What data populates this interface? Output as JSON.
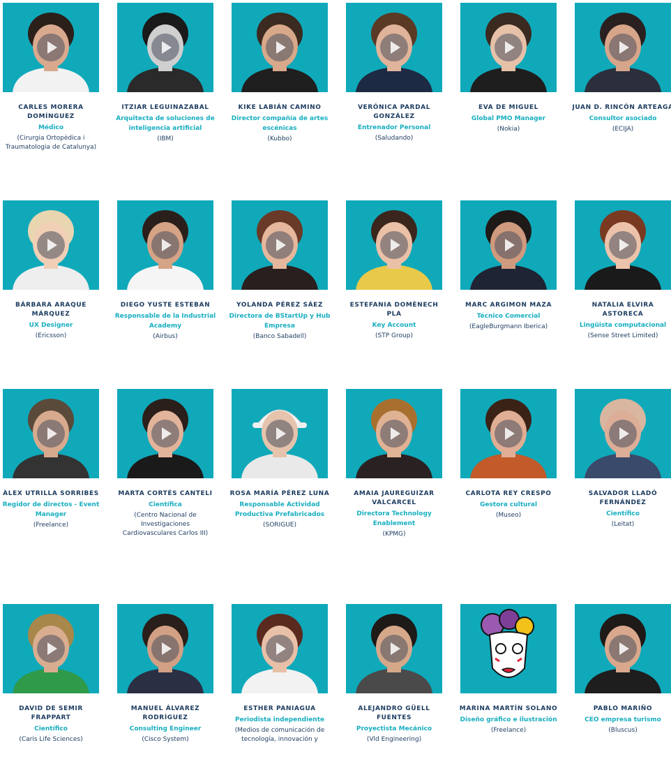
{
  "theme": {
    "photo_bg": "#0fa9ba",
    "name_color": "#1b3b5f",
    "role_color": "#18aec0"
  },
  "speakers": [
    {
      "name": "CARLES MORERA DOMÍNGUEZ",
      "role": "Médico",
      "company": "(Cirurgia Ortopèdica i Traumatologia de Catalunya)",
      "icon": "play-icon"
    },
    {
      "name": "ITZIAR LEGUINAZABAL",
      "role": "Arquitecta de soluciones de inteligencia artificial",
      "company": "(IBM)",
      "icon": "play-icon"
    },
    {
      "name": "KIKE LABIÁN CAMINO",
      "role": "Director compañía de artes escénicas",
      "company": "(Kubbo)",
      "icon": "play-icon"
    },
    {
      "name": "VERÓNICA PARDAL GONZÁLEZ",
      "role": "Entrenador Personal",
      "company": "(Saludando)",
      "icon": "play-icon"
    },
    {
      "name": "EVA DE MIGUEL",
      "role": "Global PMO Manager",
      "company": "(Nokia)",
      "icon": "play-icon"
    },
    {
      "name": "JUAN D. RINCÓN ARTEAGA",
      "role": "Consultor asociado",
      "company": "(ECIJA)",
      "icon": "play-icon"
    },
    {
      "name": "BÁRBARA ARAQUE MÁRQUEZ",
      "role": "UX Designer",
      "company": "(Ericsson)",
      "icon": "play-icon"
    },
    {
      "name": "DIEGO YUSTE ESTEBAN",
      "role": "Responsable de la Industrial Academy",
      "company": "(Airbus)",
      "icon": "play-icon"
    },
    {
      "name": "YOLANDA PÉREZ SÁEZ",
      "role": "Directora de BStartUp y Hub Empresa",
      "company": "(Banco Sabadell)",
      "icon": "play-icon"
    },
    {
      "name": "ESTEFANIA DOMÈNECH PLA",
      "role": "Key Account",
      "company": "(STP Group)",
      "icon": "play-icon"
    },
    {
      "name": "MARC ARGIMON MAZA",
      "role": "Técnico Comercial",
      "company": "(EagleBurgmann Iberica)",
      "icon": "play-icon"
    },
    {
      "name": "NATALIA ELVIRA ASTORECA",
      "role": "Lingüista computacional",
      "company": "(Sense Street Limited)",
      "icon": "play-icon"
    },
    {
      "name": "ÀLEX UTRILLA SORRIBES",
      "role": "Regidor de directos - Event Manager",
      "company": "(Freelance)",
      "icon": "play-icon"
    },
    {
      "name": "MARTA CORTÉS CANTELI",
      "role": "Científica",
      "company": "(Centro Nacional de Investigaciones Cardiovasculares Carlos III)",
      "icon": "play-icon"
    },
    {
      "name": "ROSA MARÍA PÉREZ LUNA",
      "role": "Responsable Actividad Productiva Prefabricados",
      "company": "(SORIGUE)",
      "icon": "play-icon"
    },
    {
      "name": "AMAIA JAUREGUIZAR VALCARCEL",
      "role": "Directora Technology Enablement",
      "company": "(KPMG)",
      "icon": "play-icon"
    },
    {
      "name": "CARLOTA REY CRESPO",
      "role": "Gestora cultural",
      "company": "(Museo)",
      "icon": "play-icon"
    },
    {
      "name": "SALVADOR LLADÓ FERNÁNDEZ",
      "role": "Científico",
      "company": "(Leitat)",
      "icon": "play-icon"
    },
    {
      "name": "DAVID DE SEMIR FRAPPART",
      "role": "Científico",
      "company": "(Caris Life Sciences)",
      "icon": "play-icon"
    },
    {
      "name": "MANUEL ÁLVAREZ RODRÍGUEZ",
      "role": "Consulting Engineer",
      "company": "(Cisco System)",
      "icon": "play-icon"
    },
    {
      "name": "ESTHER PANIAGUA",
      "role": "Periodista independiente",
      "company": "(Medios de comunicación de tecnología, innovación y",
      "icon": "play-icon"
    },
    {
      "name": "ALEJANDRO GÜELL FUENTES",
      "role": "Proyectista Mecánico",
      "company": "(Vld Engineering)",
      "icon": "play-icon"
    },
    {
      "name": "MARINA MARTÍN SOLANO",
      "role": "Diseño gráfico e ilustración",
      "company": "(Freelance)",
      "icon": "mask-illustration"
    },
    {
      "name": "PABLO MARIÑO",
      "role": "CEO empresa turismo",
      "company": "(Bluscus)",
      "icon": "play-icon"
    }
  ]
}
